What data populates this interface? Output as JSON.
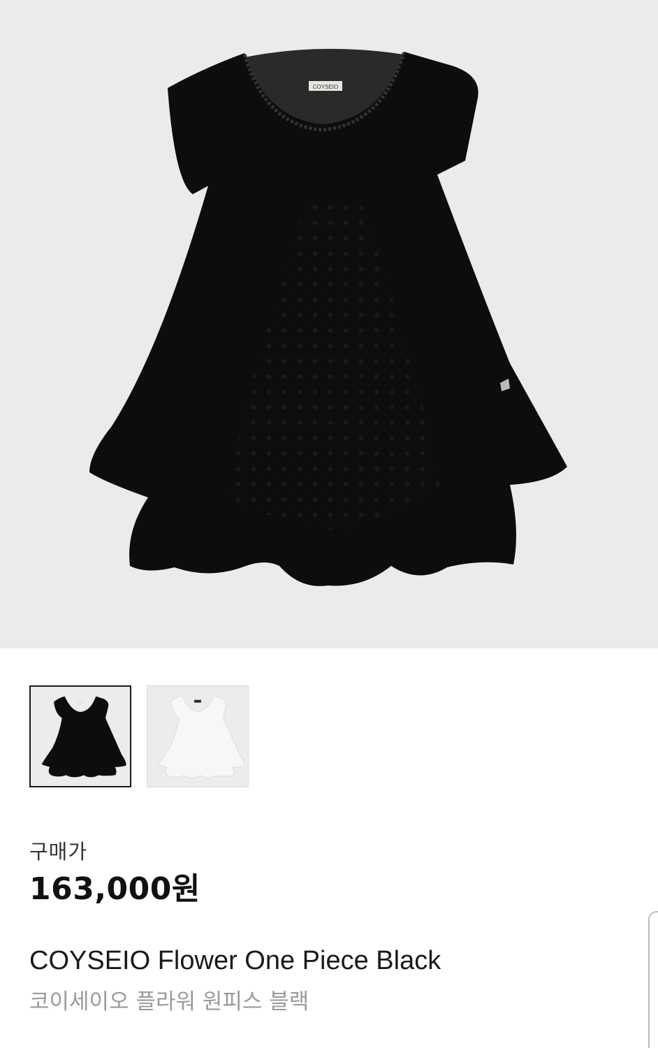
{
  "product": {
    "brand_label": "COYSEIO",
    "price_label": "구매가",
    "price": "163,000원",
    "name_en": "COYSEIO Flower One Piece Black",
    "name_ko": "코이세이오 플라워 원피스 블랙"
  },
  "thumbnails": [
    {
      "color": "black",
      "selected": true
    },
    {
      "color": "white",
      "selected": false
    }
  ],
  "colors": {
    "hero_background": "#ebebeb",
    "dress_black": "#0d0d0d",
    "dress_white": "#f7f7f5",
    "selected_border": "#1a1a1a"
  }
}
